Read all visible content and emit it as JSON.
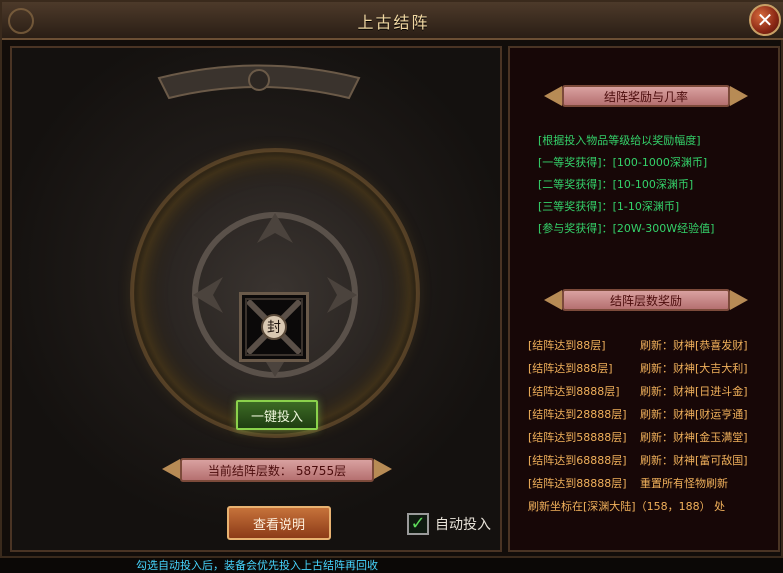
{
  "window": {
    "title": "上古结阵",
    "close_icon": "close-icon"
  },
  "left_panel": {
    "seal_char": "封",
    "invest_button": "一键投入",
    "current_layers": {
      "label": "当前结阵层数：",
      "value": "58755层"
    },
    "view_button": "查看说明",
    "auto_invest": {
      "label": "自动投入",
      "checked": true
    },
    "hint": "勾选自动投入后，装备会优先投入上古结阵再回收"
  },
  "right_panel": {
    "reward_title": "结阵奖励与几率",
    "reward_lines": [
      "[根据投入物品等级给以奖励幅度]",
      "[一等奖获得]：[100-1000深渊币]",
      "[二等奖获得]：[10-100深渊币]",
      "[三等奖获得]：[1-10深渊币]",
      "[参与奖获得]：[20W-300W经验值]"
    ],
    "layers_title": "结阵层数奖励",
    "layer_rewards": [
      {
        "req": "[结阵达到88层]",
        "reward": "刷新：财神[恭喜发财]"
      },
      {
        "req": "[结阵达到888层]",
        "reward": "刷新：财神[大吉大利]"
      },
      {
        "req": "[结阵达到8888层]",
        "reward": "刷新：财神[日进斗金]"
      },
      {
        "req": "[结阵达到28888层]",
        "reward": "刷新：财神[财运亨通]"
      },
      {
        "req": "[结阵达到58888层]",
        "reward": "刷新：财神[金玉满堂]"
      },
      {
        "req": "[结阵达到68888层]",
        "reward": "刷新：财神[富可敌国]"
      },
      {
        "req": "[结阵达到88888层]",
        "reward": "重置所有怪物刷新"
      }
    ],
    "coords": "刷新坐标在[深渊大陆]（158，188） 处"
  },
  "colors": {
    "green_text": "#34d26a",
    "orange_text": "#f0b05b",
    "hint_text": "#47d6ff",
    "banner_fill": "#c68686",
    "title_text": "#f0d7a2"
  }
}
